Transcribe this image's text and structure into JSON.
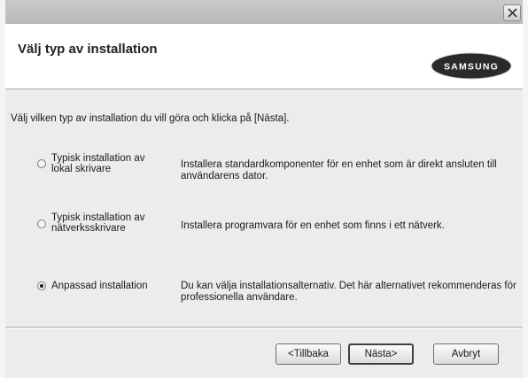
{
  "window": {
    "title": ""
  },
  "header": {
    "title": "Välj typ av installation",
    "brand": "SAMSUNG"
  },
  "instruction": "Välj vilken typ av installation du vill göra och klicka på [Nästa].",
  "options": [
    {
      "label_line1": "Typisk installation av",
      "label_line2": "lokal skrivare",
      "description": "Installera standardkomponenter för en enhet som är direkt ansluten till användarens dator.",
      "selected": false
    },
    {
      "label_line1": "Typisk installation av",
      "label_line2": "nätverksskrivare",
      "description": "Installera programvara för en enhet som finns i ett nätverk.",
      "selected": false
    },
    {
      "label_line1": "Anpassad installation",
      "label_line2": "",
      "description": "Du kan välja installationsalternativ. Det här alternativet rekommenderas för professionella användare.",
      "selected": true
    }
  ],
  "buttons": {
    "back": "<Tillbaka",
    "next": "Nästa>",
    "cancel": "Avbryt"
  },
  "icons": {
    "close": "close-icon",
    "radio": "radio-button-icon"
  },
  "colors": {
    "window_bg": "#ececec",
    "header_bg": "#ffffff",
    "logo_fill": "#2a2a2a",
    "logo_text": "#ffffff"
  }
}
